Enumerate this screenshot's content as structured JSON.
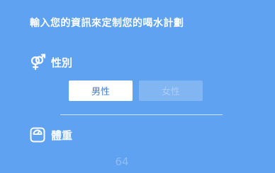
{
  "header": {
    "title": "輸入您的資訊來定制您的喝水計劃"
  },
  "gender_section": {
    "icon": "gender-icon",
    "label": "性別",
    "options": [
      {
        "label": "男性",
        "selected": true
      },
      {
        "label": "女性",
        "selected": false
      }
    ]
  },
  "weight_section": {
    "icon": "scale-icon",
    "label": "體重",
    "value": "64"
  },
  "colors": {
    "background": "#5ea2f1",
    "selected_text": "#3f7dd0",
    "unselected_bg": "#81b6f3"
  }
}
